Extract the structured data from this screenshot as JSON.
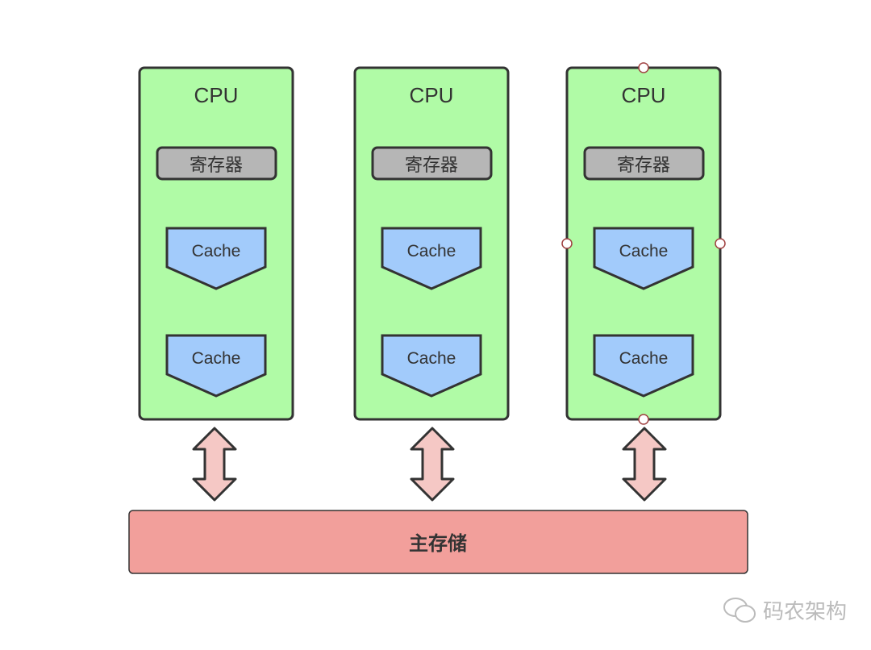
{
  "cpus": [
    {
      "label": "CPU",
      "register": "寄存器",
      "caches": [
        "Cache",
        "Cache"
      ]
    },
    {
      "label": "CPU",
      "register": "寄存器",
      "caches": [
        "Cache",
        "Cache"
      ]
    },
    {
      "label": "CPU",
      "register": "寄存器",
      "caches": [
        "Cache",
        "Cache"
      ]
    }
  ],
  "main_memory": "主存储",
  "watermark": "码农架构",
  "colors": {
    "cpu": "#b0fba6",
    "register": "#b6b6b6",
    "cache": "#a2cbfb",
    "arrow": "#f5c8c5",
    "memory": "#f29f9b",
    "stroke": "#333333",
    "handle": "#a04040"
  },
  "selected_cpu_index": 2
}
